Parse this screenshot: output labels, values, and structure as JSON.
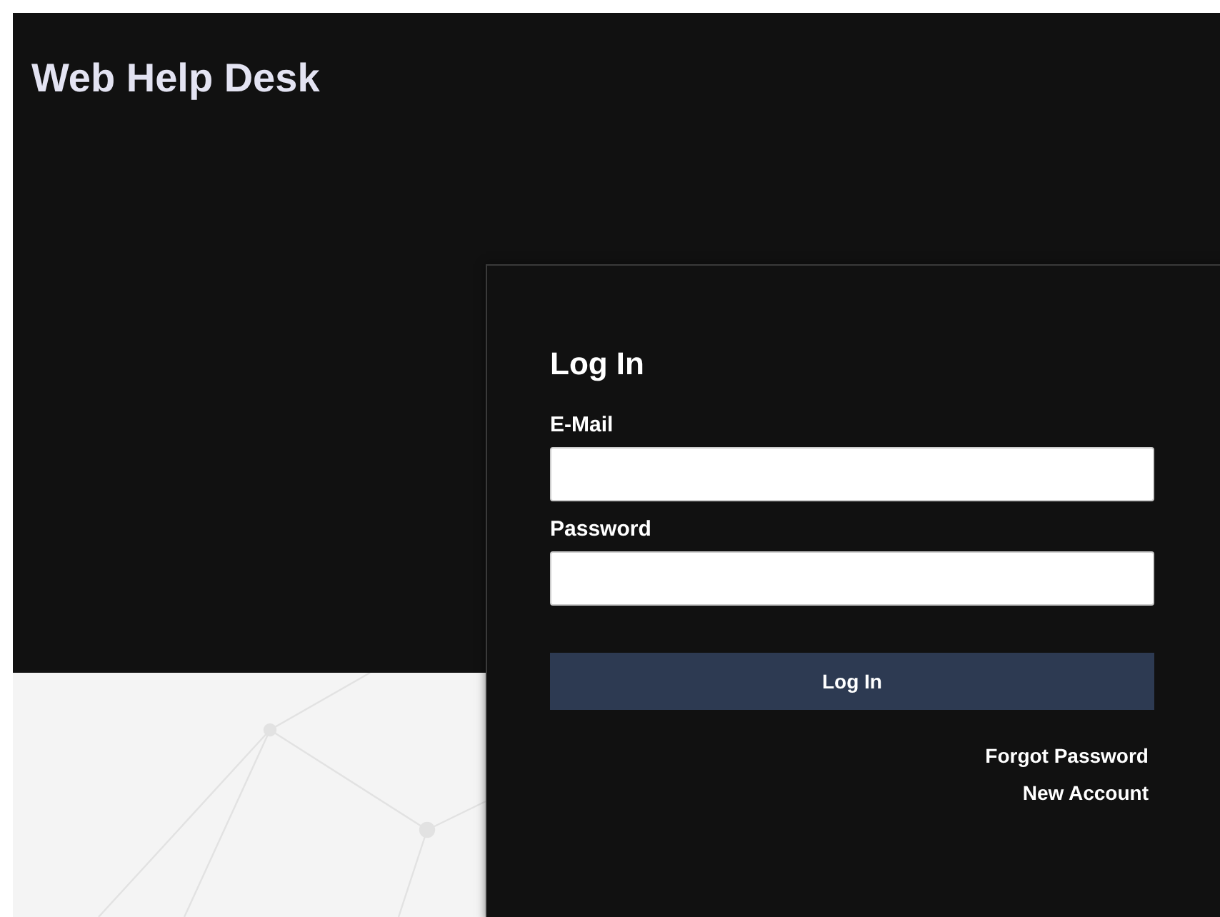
{
  "header": {
    "title": "Web Help Desk"
  },
  "login": {
    "heading": "Log In",
    "fields": [
      {
        "label": "E-Mail"
      },
      {
        "label": "Password"
      }
    ],
    "button": "Log In",
    "links": [
      "Forgot Password",
      "New Account"
    ]
  }
}
